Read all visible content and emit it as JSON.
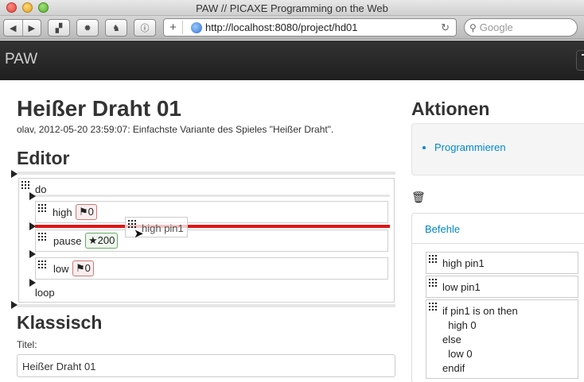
{
  "browser": {
    "window_title": "PAW // PICAXE Programming on the Web",
    "url": "http://localhost:8080/project/hd01",
    "search_placeholder": "Google"
  },
  "app": {
    "brand": "PAW"
  },
  "page": {
    "title": "Heißer Draht 01",
    "meta": "olav, 2012-05-20 23:59:07: Einfachste Variante des Spieles \"Heißer Draht\"."
  },
  "editor": {
    "heading": "Editor",
    "do_label": "do",
    "loop_label": "loop",
    "statements": [
      {
        "keyword": "high",
        "param": "⚑0",
        "param_color": "red"
      },
      {
        "keyword": "pause",
        "param": "★200",
        "param_color": "green"
      },
      {
        "keyword": "low",
        "param": "⚑0",
        "param_color": "red"
      }
    ],
    "drag_ghost": "high pin1"
  },
  "klassisch": {
    "heading": "Klassisch",
    "title_label": "Titel:",
    "title_value": "Heißer Draht 01"
  },
  "sidebar": {
    "heading": "Aktionen",
    "actions": [
      "Programmieren"
    ],
    "panel_title": "Befehle",
    "commands": [
      "high pin1",
      "low pin1",
      "if pin1 is on then\n  high 0\nelse\n  low 0\nendif"
    ]
  },
  "colors": {
    "drop_indicator": "#e01515",
    "link": "#0088cc",
    "navbar": "#222222"
  }
}
